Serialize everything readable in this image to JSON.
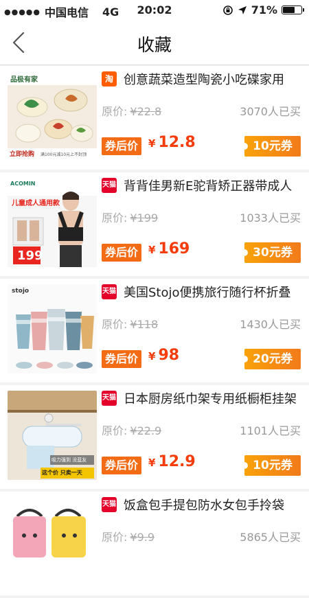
{
  "status_bar": {
    "carrier": "中国电信",
    "network": "4G",
    "time": "20:02",
    "battery_text": "71%",
    "battery_level": 0.71
  },
  "nav": {
    "title": "收藏"
  },
  "labels": {
    "original_price": "原价:",
    "after_coupon": "券后价",
    "currency": "¥"
  },
  "items": [
    {
      "shop_type": "taobao",
      "badge": "淘",
      "name": "创意蔬菜造型陶瓷小吃碟家用",
      "original_price": "¥22.8",
      "sold": "3070人已买",
      "after_price": "12.8",
      "coupon": "10元券",
      "thumb_banner": "品极有家",
      "thumb_footer": "立即抢购",
      "thumb_note": "满100元减10元上不封顶"
    },
    {
      "shop_type": "tmall",
      "badge": "天猫",
      "name": "背背佳男新E驼背矫正器带成人",
      "original_price": "¥199",
      "sold": "1033人已买",
      "after_price": "169",
      "coupon": "30元券",
      "thumb_banner": "ACOMIN",
      "thumb_text1": "儿童成人通用款",
      "thumb_text2": "199"
    },
    {
      "shop_type": "tmall",
      "badge": "天猫",
      "name": "美国Stojo便携旅行随行杯折叠",
      "original_price": "¥118",
      "sold": "1430人已买",
      "after_price": "98",
      "coupon": "20元券",
      "thumb_banner": "stojo"
    },
    {
      "shop_type": "tmall",
      "badge": "天猫",
      "name": "日本厨房纸巾架专用纸橱柜挂架",
      "original_price": "¥22.9",
      "sold": "1101人已买",
      "after_price": "12.9",
      "coupon": "10元券",
      "thumb_text1": "吸力强到 没蓝友",
      "thumb_text2": "这个价 只卖一天"
    },
    {
      "shop_type": "tmall",
      "badge": "天猫",
      "name": "饭盒包手提包防水女包手拎袋",
      "original_price": "¥9.9",
      "sold": "5865人已买",
      "after_price": "",
      "coupon": ""
    }
  ]
}
